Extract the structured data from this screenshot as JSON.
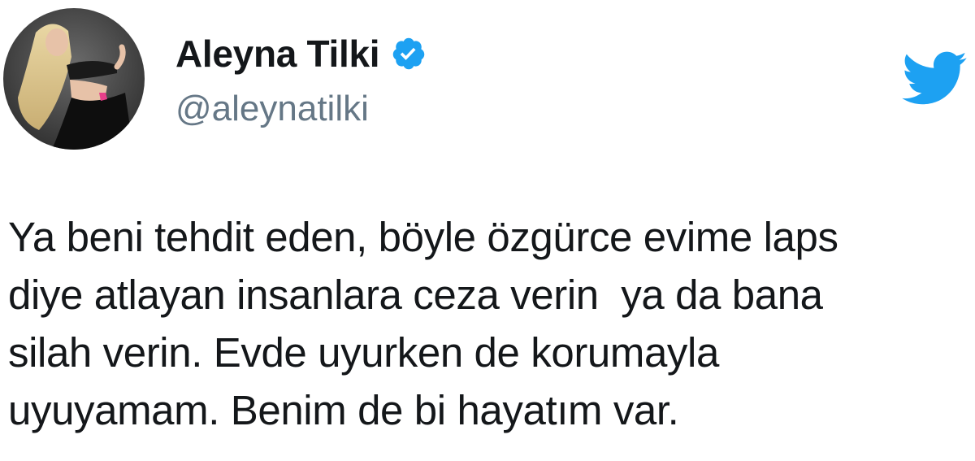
{
  "profile": {
    "display_name": "Aleyna Tilki",
    "handle": "@aleynatilki",
    "verified": true
  },
  "icons": {
    "verified": "verified-badge-icon",
    "brand": "twitter-bird-icon"
  },
  "colors": {
    "brand": "#1da1f2",
    "handle": "#657786",
    "text": "#14171a"
  },
  "tweet": {
    "lines": [
      "Ya beni tehdit eden, böyle özgürce evime laps",
      "diye atlayan insanlara ceza verin  ya da bana",
      "silah verin. Evde uyurken de korumayla",
      "uyuyamam. Benim de bi hayatım var."
    ]
  }
}
